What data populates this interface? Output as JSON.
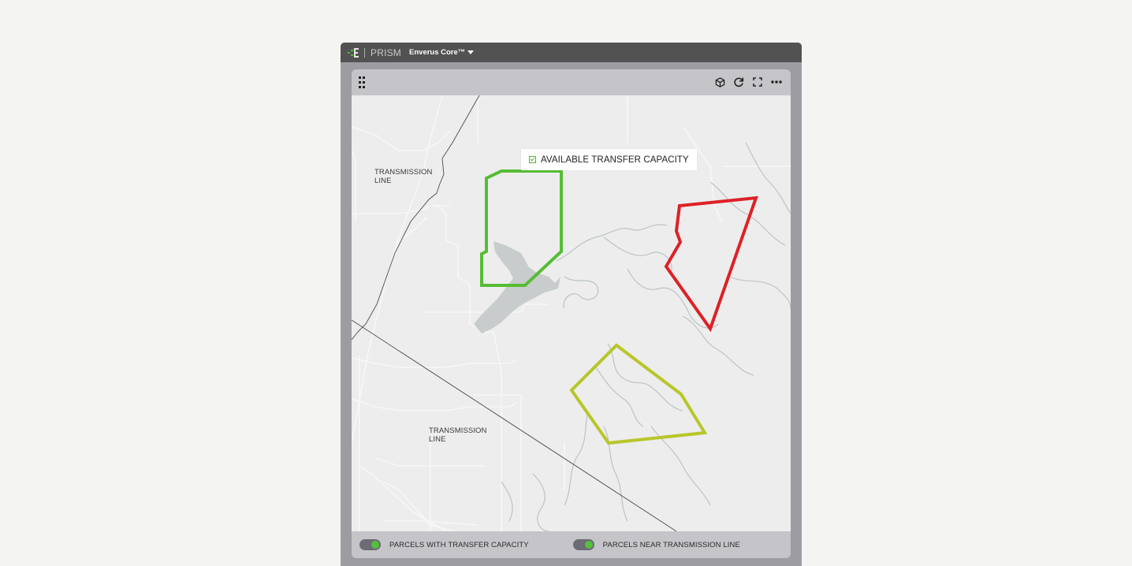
{
  "topbar": {
    "brand_name": "PRISM",
    "product_name": "Enverus Core™",
    "logo_icon": "enverus-logo-icon",
    "product_menu_icon": "caret-down-icon"
  },
  "widget": {
    "header_tools": [
      {
        "name": "cube-icon",
        "label": "3D view"
      },
      {
        "name": "refresh-icon",
        "label": "Refresh"
      },
      {
        "name": "fullscreen-icon",
        "label": "Fullscreen"
      },
      {
        "name": "more-icon",
        "label": "More options"
      }
    ],
    "map": {
      "tooltip": {
        "label": "AVAILABLE TRANSFER CAPACITY",
        "checked": true
      },
      "labels": [
        {
          "line1": "TRANSMISSION",
          "line2": "LINE"
        },
        {
          "line1": "TRANSMISSION",
          "line2": "LINE"
        }
      ],
      "parcels": [
        {
          "name": "parcel-available-transfer-capacity",
          "color": "#56bd35"
        },
        {
          "name": "parcel-high-risk",
          "color": "#dd2126"
        },
        {
          "name": "parcel-near-transmission-line",
          "color": "#b8c62a"
        }
      ]
    },
    "footer": {
      "toggles": [
        {
          "label": "PARCELS WITH TRANSFER CAPACITY",
          "on": true
        },
        {
          "label": "PARCELS NEAR TRANSMISSION LINE",
          "on": true
        }
      ],
      "toggle_on_color": "#55c03a"
    }
  }
}
